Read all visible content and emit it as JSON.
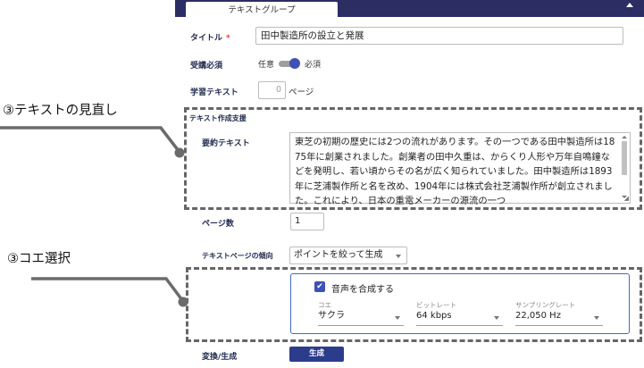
{
  "header": {
    "tab_label": "テキストグループ"
  },
  "form": {
    "title_label": "タイトル",
    "required_mark": "*",
    "title_value": "田中製造所の設立と発展",
    "required_study_label": "受講必須",
    "toggle_off_label": "任意",
    "toggle_on_label": "必須",
    "toggle_state": "必須",
    "study_text_label": "学習テキスト",
    "study_text_pages": "0",
    "pages_suffix": "ページ",
    "text_support_label": "テキスト作成支援",
    "summary_label": "要約テキスト",
    "summary_text": "東芝の初期の歴史には2つの流れがあります。その一つである田中製造所は1875年に創業されました。創業者の田中久重は、からくり人形や万年自鳴鐘などを発明し、若い頃からその名が広く知られていました。田中製造所は1893年に芝浦製作所と名を改め、1904年には株式会社芝浦製作所が創立されました。これにより、日本の重電メーカーの源流の一つ",
    "page_count_label": "ページ数",
    "page_count_value": "1",
    "tendency_label": "テキストページの傾向",
    "tendency_value": "ポイントを絞って生成",
    "synthesize_label": "音声を合成する",
    "synthesize_checked": true,
    "voice_caption": "コエ",
    "voice_value": "サクラ",
    "bitrate_caption": "ビットレート",
    "bitrate_value": "64 kbps",
    "samplerate_caption": "サンプリングレート",
    "samplerate_value": "22,050 Hz",
    "convert_label": "変換/生成",
    "generate_button": "生成"
  },
  "annotations": {
    "review_text": "③テキストの見直し",
    "voice_select": "③コエ選択"
  },
  "colors": {
    "header_bg": "#2c2d63",
    "accent": "#3f51b5",
    "button_bg": "#2c3c8c",
    "label": "#1f2a4e",
    "required": "#e53935"
  }
}
